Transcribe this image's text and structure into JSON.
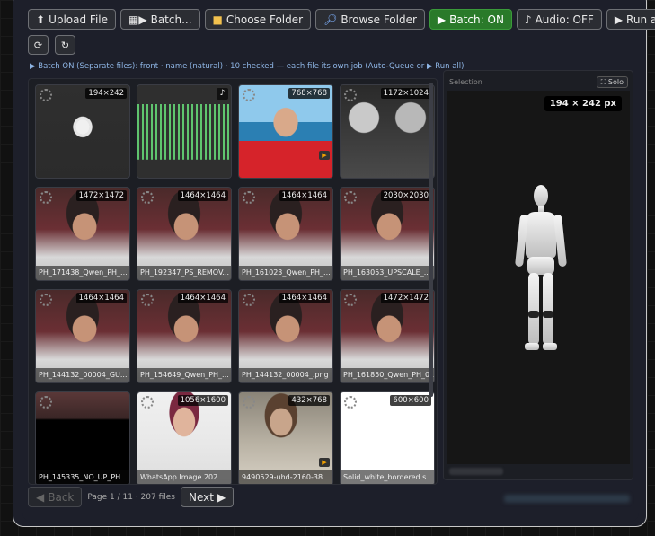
{
  "toolbar": {
    "upload_label": "Upload File",
    "batch_label": "Batch...",
    "choose_folder_label": "Choose Folder",
    "browse_folder_label": "Browse Folder",
    "batch_toggle_label": "Batch: ON",
    "audio_toggle_label": "Audio: OFF",
    "run_all_label": "Run all"
  },
  "info_line": "Batch ON (Separate files): front · name (natural) · 10 checked — each file its own job (Auto-Queue or ▶ Run all)",
  "tiles": [
    {
      "badge": "194×242",
      "name": "",
      "kind": "mannequin"
    },
    {
      "badge": "",
      "name": "",
      "kind": "audio"
    },
    {
      "badge": "768×768",
      "name": "",
      "kind": "beach",
      "video": true
    },
    {
      "badge": "1172×1024",
      "name": "",
      "kind": "tattoo"
    },
    {
      "badge": "1472×1472",
      "name": "PH_171438_Qwen_PH_...",
      "kind": "portrait"
    },
    {
      "badge": "1464×1464",
      "name": "PH_192347_PS_REMOV...",
      "kind": "portrait"
    },
    {
      "badge": "1464×1464",
      "name": "PH_161023_Qwen_PH_...",
      "kind": "portrait"
    },
    {
      "badge": "2030×2030",
      "name": "PH_163053_UPSCALE_...",
      "kind": "portrait"
    },
    {
      "badge": "1464×1464",
      "name": "PH_144132_00004_GU...",
      "kind": "portrait"
    },
    {
      "badge": "1464×1464",
      "name": "PH_154649_Qwen_PH_...",
      "kind": "portrait"
    },
    {
      "badge": "1464×1464",
      "name": "PH_144132_00004_.png",
      "kind": "portrait"
    },
    {
      "badge": "1472×1472",
      "name": "PH_161850_Qwen_PH_0...",
      "kind": "portrait"
    },
    {
      "badge": "",
      "name": "PH_145335_NO_UP_PH...",
      "kind": "dark"
    },
    {
      "badge": "1056×1600",
      "name": "WhatsApp Image 202...",
      "kind": "tshirt"
    },
    {
      "badge": "432×768",
      "name": "9490529-uhd-2160-38...",
      "kind": "writer",
      "video": true
    },
    {
      "badge": "600×600",
      "name": "Solid_white_bordered.s...",
      "kind": "white"
    }
  ],
  "selection": {
    "label": "Selection",
    "solo_label": "Solo",
    "dimensions": "194 × 242 px"
  },
  "footer": {
    "back_label": "Back",
    "page_info": "Page 1 / 11 · 207 files",
    "next_label": "Next"
  },
  "colors": {
    "panel_bg": "#1d1f2a",
    "green_button": "#2a7a2a",
    "info_text": "#8fb6e6"
  }
}
